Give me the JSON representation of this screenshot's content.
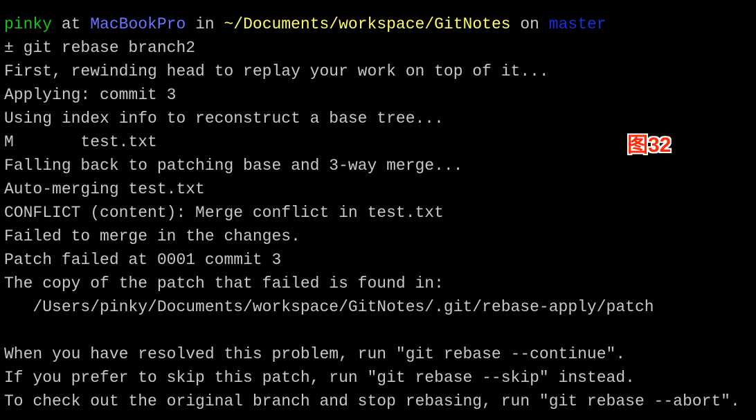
{
  "prompt": {
    "user": "pinky",
    "at": " at ",
    "host": "MacBookPro",
    "in": " in ",
    "path": "~/Documents/workspace/GitNotes",
    "on": " on ",
    "branch": "master"
  },
  "colors": {
    "user": "#19c419",
    "host": "#6c72ff",
    "path": "#fefb67",
    "branch": "#1b2fdf",
    "text": "#c7c7c7",
    "background": "#000000",
    "label": "#ff2a0a"
  },
  "output_lines": [
    "± git rebase branch2",
    "First, rewinding head to replay your work on top of it...",
    "Applying: commit 3",
    "Using index info to reconstruct a base tree...",
    "M       test.txt",
    "Falling back to patching base and 3-way merge...",
    "Auto-merging test.txt",
    "CONFLICT (content): Merge conflict in test.txt",
    "Failed to merge in the changes.",
    "Patch failed at 0001 commit 3",
    "The copy of the patch that failed is found in:",
    "   /Users/pinky/Documents/workspace/GitNotes/.git/rebase-apply/patch",
    "",
    "When you have resolved this problem, run \"git rebase --continue\".",
    "If you prefer to skip this patch, run \"git rebase --skip\" instead.",
    "To check out the original branch and stop rebasing, run \"git rebase --abort\"."
  ],
  "figure_label": "图32"
}
